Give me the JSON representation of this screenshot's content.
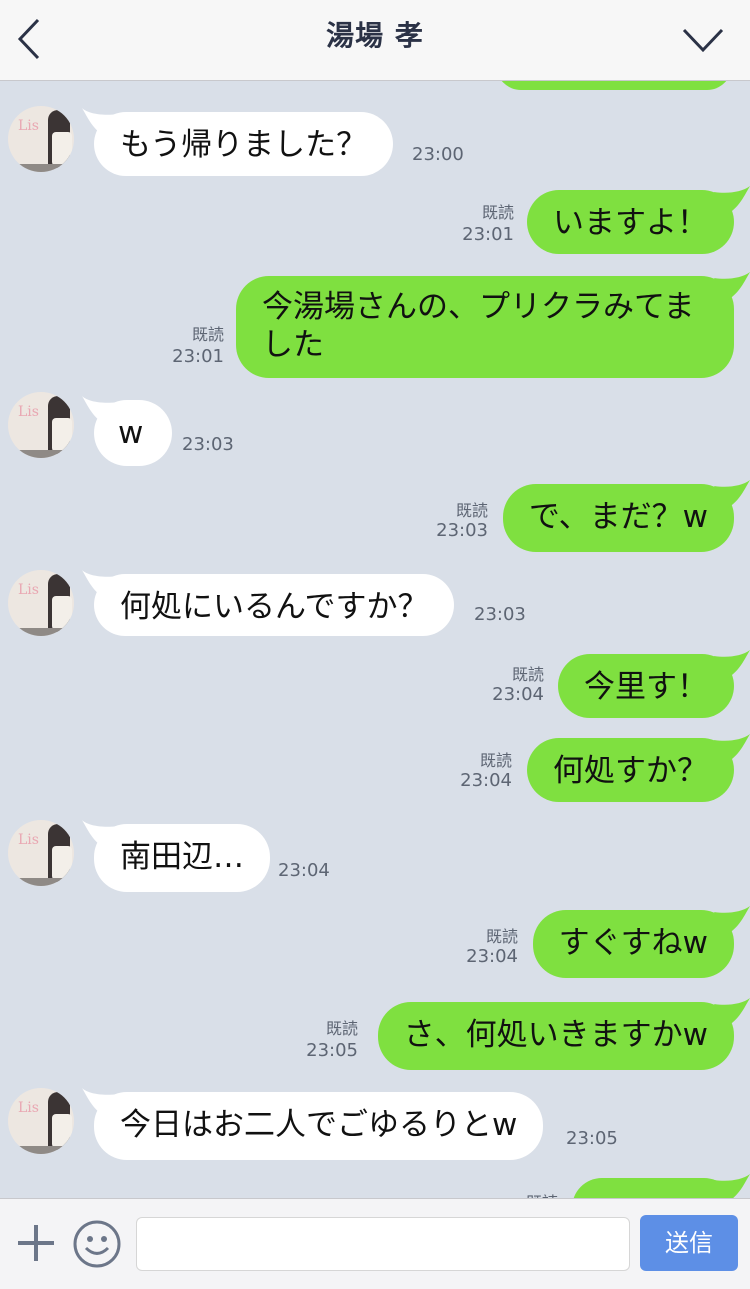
{
  "header": {
    "title": "湯場 孝",
    "back_icon": "chevron-left-icon",
    "menu_icon": "chevron-down-icon"
  },
  "colors": {
    "background": "#d9dfe8",
    "outgoing": "#7fe040",
    "incoming": "#ffffff",
    "send": "#5d8fe6"
  },
  "avatar_text": "Lis",
  "messages": [
    {
      "from": "in",
      "text": "もう帰りました？",
      "time": "23:00"
    },
    {
      "from": "out",
      "text": "いますよ！",
      "read": "既読",
      "time": "23:01"
    },
    {
      "from": "out",
      "text": "今湯場さんの、プリクラみてました",
      "read": "既読",
      "time": "23:01"
    },
    {
      "from": "in",
      "text": "w",
      "time": "23:03"
    },
    {
      "from": "out",
      "text": "で、まだ？w",
      "read": "既読",
      "time": "23:03"
    },
    {
      "from": "in",
      "text": "何処にいるんですか？",
      "time": "23:03"
    },
    {
      "from": "out",
      "text": "今里す！",
      "read": "既読",
      "time": "23:04"
    },
    {
      "from": "out",
      "text": "何処すか？",
      "read": "既読",
      "time": "23:04"
    },
    {
      "from": "in",
      "text": "南田辺…",
      "time": "23:04"
    },
    {
      "from": "out",
      "text": "すぐすねw",
      "read": "既読",
      "time": "23:04"
    },
    {
      "from": "out",
      "text": "さ、何処いきますかw",
      "read": "既読",
      "time": "23:05"
    },
    {
      "from": "in",
      "text": "今日はお二人でごゆるりとw",
      "time": "23:05"
    },
    {
      "from": "out",
      "text": "",
      "read": "既読",
      "time": ""
    }
  ],
  "composer": {
    "plus_icon": "plus-icon",
    "sticker_icon": "smiley-icon",
    "input_value": "",
    "send_label": "送信"
  }
}
